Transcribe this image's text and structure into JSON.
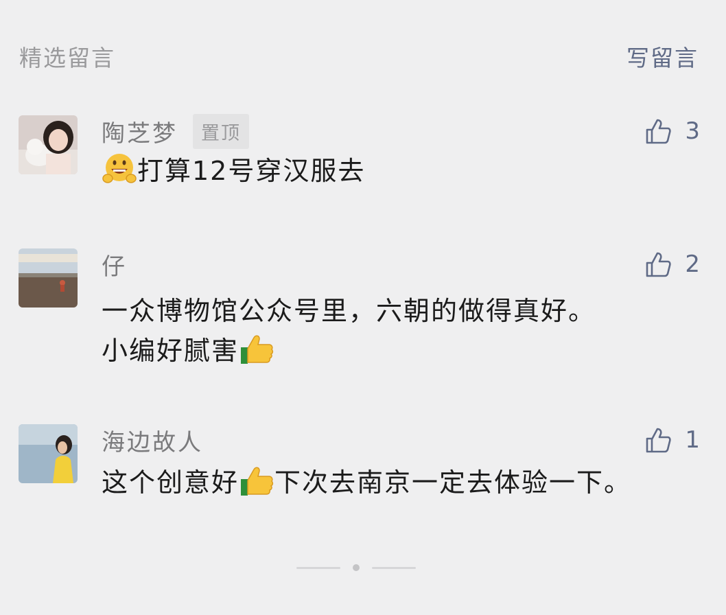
{
  "header": {
    "title": "精选留言",
    "write_label": "写留言"
  },
  "comments": [
    {
      "nickname": "陶芝梦",
      "badge": "置顶",
      "likes": "3",
      "lines": [
        {
          "emoji": "grinning-hands-emoji",
          "text": "打算12号穿汉服去"
        }
      ]
    },
    {
      "nickname": "仔",
      "likes": "2",
      "lines": [
        {
          "text": "一众博物馆公众号里，六朝的做得真好。"
        },
        {
          "text": "小编好腻害",
          "emoji_after": "thumbs-up-emoji"
        }
      ]
    },
    {
      "nickname": "海边故人",
      "likes": "1",
      "lines": [
        {
          "text_before": "这个创意好",
          "emoji": "thumbs-up-emoji",
          "text_after": "下次去南京一定去体验一下。"
        }
      ]
    }
  ],
  "colors": {
    "background": "#efeff0",
    "link": "#5f6a86",
    "muted": "#9a9a9c",
    "text": "#1b1b1b"
  }
}
